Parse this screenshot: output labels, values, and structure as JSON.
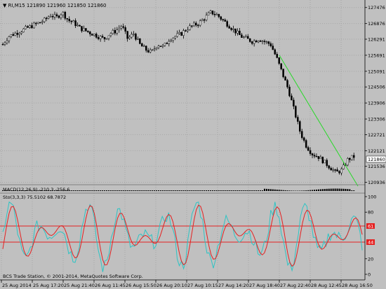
{
  "main_window": {
    "symbol_line": "RI,M15  121890 121960 121850 121860",
    "current_price": "121860"
  },
  "price_axis": {
    "labels": [
      "127476",
      "126876",
      "126291",
      "125691",
      "125091",
      "124506",
      "123906",
      "123306",
      "122721",
      "122121",
      "121536",
      "120936"
    ]
  },
  "macd": {
    "label": "MACD(12,26,9) -210.3 -256.6"
  },
  "stochastic": {
    "label": "Sto(3,3,3) 75.5102 68.7872",
    "axis_labels": [
      "100",
      "80",
      "61",
      "44",
      "20",
      "0"
    ],
    "levels": [
      61,
      44
    ]
  },
  "time_axis": {
    "labels": [
      "25 Aug 2014",
      "25 Aug 17:20",
      "25 Aug 21:40",
      "26 Aug 11:45",
      "26 Aug 15:50",
      "26 Aug 20:10",
      "27 Aug 10:15",
      "27 Aug 14:20",
      "27 Aug 18:40",
      "27 Aug 22:40",
      "28 Aug 12:45",
      "28 Aug 16:50"
    ]
  },
  "footer": {
    "copyright": "BCS Trade Station, © 2001-2014, MetaQuotes Software Corp."
  },
  "colors": {
    "background": "#c0c0c0",
    "grid": "#a6a6a6",
    "candle": "#000000",
    "trendline": "#27d927",
    "stoch_main": "#2ec4c4",
    "stoch_signal": "#e52020",
    "level_line": "#e52020",
    "price_marker": "#ffffff"
  },
  "chart_data": {
    "type": "line",
    "series": [
      {
        "values": [
          126100,
          126400,
          126500,
          126600,
          126700,
          126800,
          126900,
          127000,
          127200,
          127100,
          127300,
          127000,
          126900,
          126700,
          126600,
          126500,
          126400,
          126300,
          126500,
          126600,
          126800,
          126300,
          126500,
          126100,
          125900,
          125800,
          126100,
          126000,
          126300,
          126400,
          126500,
          126700,
          126800,
          126900,
          127100,
          127300,
          127200,
          127000,
          126800,
          126600,
          126400,
          126300,
          126200,
          126300,
          126200,
          126100,
          125600,
          125000,
          124400,
          123600,
          122800,
          122300,
          122000,
          121900,
          121700,
          121500,
          121300,
          121400,
          121800,
          121900
        ]
      }
    ],
    "ylim": [
      120900,
      127600
    ]
  }
}
